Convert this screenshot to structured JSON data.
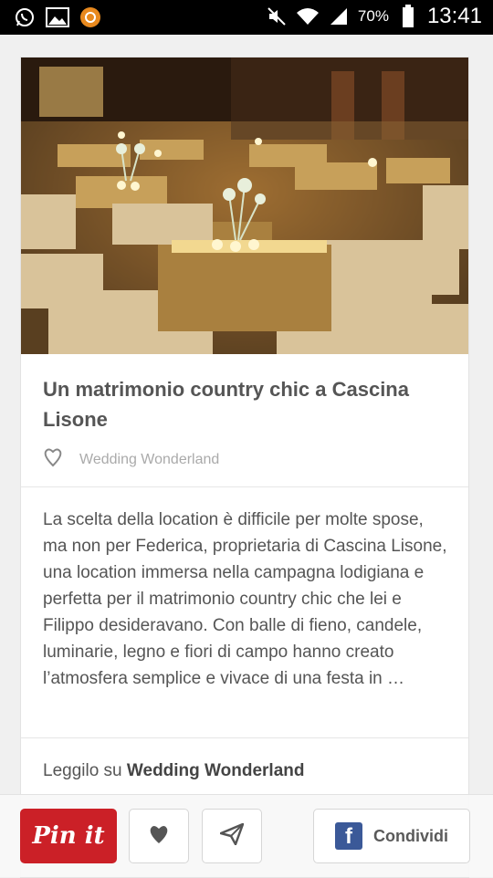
{
  "status_bar": {
    "battery_percent": "70%",
    "time": "13:41",
    "icons": [
      "whatsapp-icon",
      "gallery-icon",
      "orange-app-icon",
      "mute-icon",
      "wifi-icon",
      "signal-icon",
      "battery-icon"
    ]
  },
  "article": {
    "image_description": "wedding reception with hay bales and candles",
    "title": "Un matrimonio country chic a Cascina Lisone",
    "source_name": "Wedding Wonderland",
    "description": "La scelta della location è difficile per molte spose, ma non per Federica, proprietaria di Cascina Lisone, una location immersa nella campagna lodigiana e perfetta per il matrimonio country chic che lei e Filippo desideravano. Con balle di fieno, candele, luminarie, legno e fiori di campo hanno creato l’atmosfera semplice e vivace di una festa in …",
    "read_on_prefix": "Leggilo su",
    "read_on_source": "Wedding Wonderland"
  },
  "actions": {
    "pin_label": "Pin it",
    "share_label": "Condividi",
    "fb_letter": "f"
  },
  "colors": {
    "pin_red": "#cb2027",
    "facebook_blue": "#3b5998"
  }
}
